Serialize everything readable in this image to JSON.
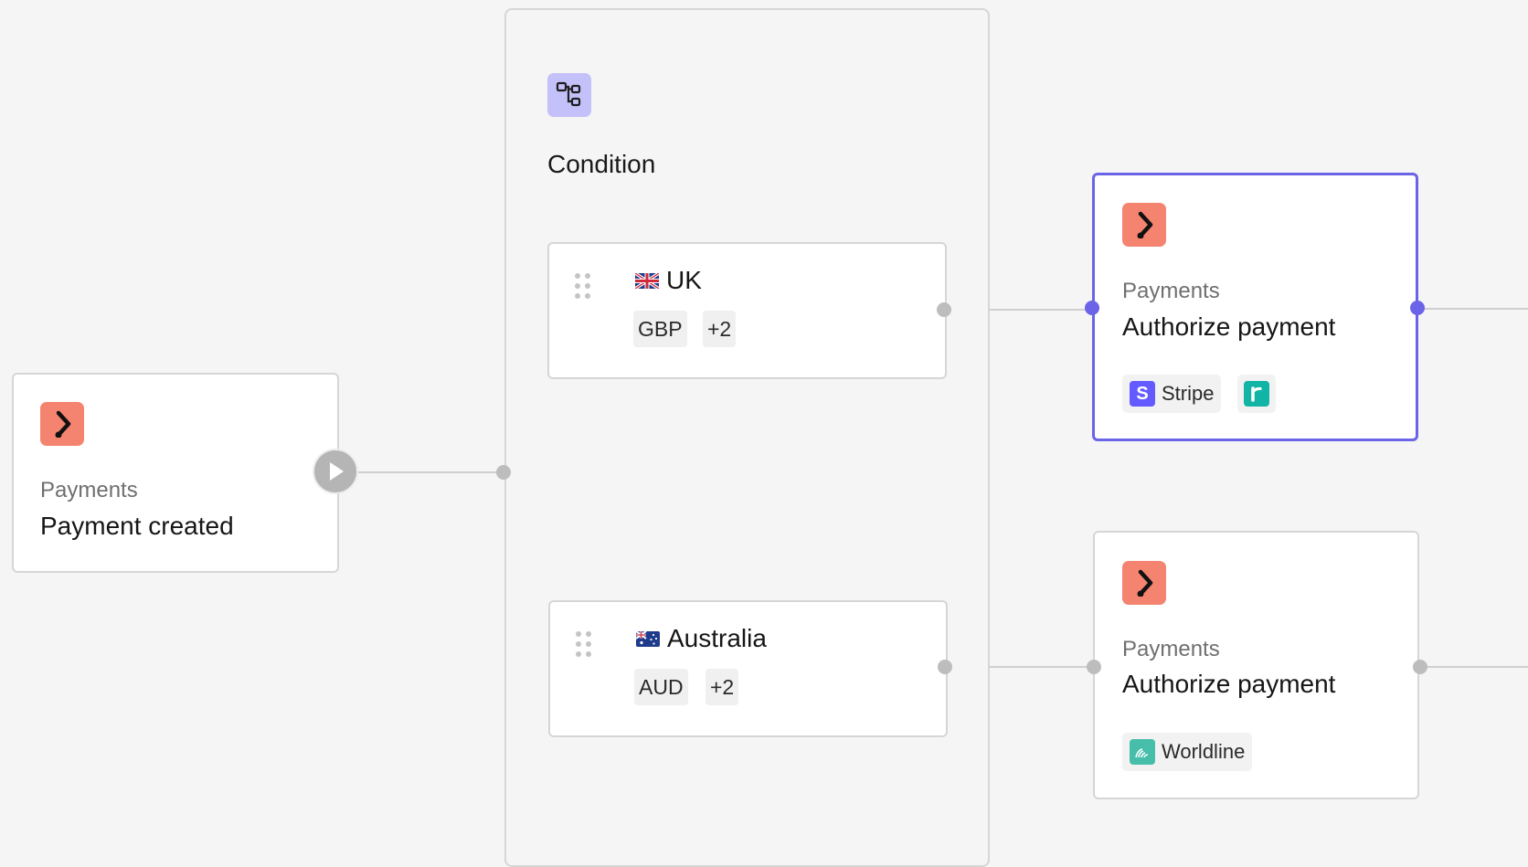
{
  "trigger": {
    "category": "Payments",
    "title": "Payment created",
    "icon": "payments-app-icon",
    "run_icon": "play-icon"
  },
  "condition": {
    "title": "Condition",
    "icon": "branch-condition-icon",
    "branches": [
      {
        "flag": "uk-flag-icon",
        "name": "UK",
        "currency": "GBP",
        "more": "+2"
      },
      {
        "flag": "australia-flag-icon",
        "name": "Australia",
        "currency": "AUD",
        "more": "+2"
      }
    ]
  },
  "actions": [
    {
      "category": "Payments",
      "title": "Authorize payment",
      "selected": true,
      "processors": [
        {
          "name": "Stripe",
          "icon": "stripe-icon"
        },
        {
          "name": "",
          "icon": "processor-r-icon"
        }
      ]
    },
    {
      "category": "Payments",
      "title": "Authorize payment",
      "selected": false,
      "processors": [
        {
          "name": "Worldline",
          "icon": "worldline-icon"
        }
      ]
    }
  ],
  "colors": {
    "canvas": "#f5f5f5",
    "accent": "#6b63e8",
    "app_icon": "#f4846f",
    "condition_icon": "#c4c1fa",
    "stripe": "#635bff",
    "processor_r": "#12b5a5",
    "worldline": "#46beaa"
  }
}
